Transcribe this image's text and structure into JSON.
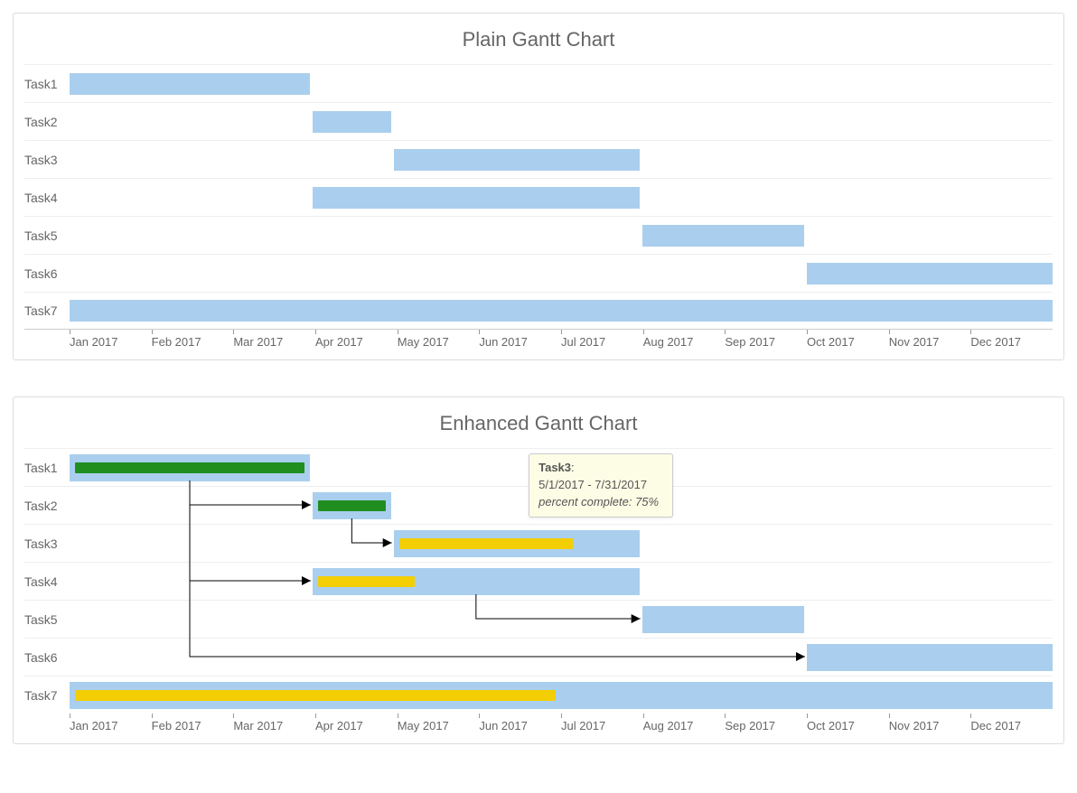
{
  "chart_data": [
    {
      "type": "gantt",
      "title": "Plain Gantt Chart",
      "x_start": "2017-01-01",
      "x_end": "2017-12-31",
      "x_ticks": [
        "Jan 2017",
        "Feb 2017",
        "Mar 2017",
        "Apr 2017",
        "May 2017",
        "Jun 2017",
        "Jul 2017",
        "Aug 2017",
        "Sep 2017",
        "Oct 2017",
        "Nov 2017",
        "Dec 2017"
      ],
      "tasks": [
        {
          "name": "Task1",
          "start": "2017-01-01",
          "end": "2017-03-31"
        },
        {
          "name": "Task2",
          "start": "2017-04-01",
          "end": "2017-04-30"
        },
        {
          "name": "Task3",
          "start": "2017-05-01",
          "end": "2017-07-31"
        },
        {
          "name": "Task4",
          "start": "2017-04-01",
          "end": "2017-07-31"
        },
        {
          "name": "Task5",
          "start": "2017-08-01",
          "end": "2017-09-30"
        },
        {
          "name": "Task6",
          "start": "2017-10-01",
          "end": "2017-12-31"
        },
        {
          "name": "Task7",
          "start": "2017-01-01",
          "end": "2017-12-31"
        }
      ]
    },
    {
      "type": "gantt",
      "title": "Enhanced Gantt Chart",
      "x_start": "2017-01-01",
      "x_end": "2017-12-31",
      "x_ticks": [
        "Jan 2017",
        "Feb 2017",
        "Mar 2017",
        "Apr 2017",
        "May 2017",
        "Jun 2017",
        "Jul 2017",
        "Aug 2017",
        "Sep 2017",
        "Oct 2017",
        "Nov 2017",
        "Dec 2017"
      ],
      "tasks": [
        {
          "name": "Task1",
          "start": "2017-01-01",
          "end": "2017-03-31",
          "percent_complete": 100,
          "progress_color": "green"
        },
        {
          "name": "Task2",
          "start": "2017-04-01",
          "end": "2017-04-30",
          "percent_complete": 100,
          "progress_color": "green",
          "depends_on": "Task1"
        },
        {
          "name": "Task3",
          "start": "2017-05-01",
          "end": "2017-07-31",
          "percent_complete": 75,
          "progress_color": "gold",
          "depends_on": "Task2"
        },
        {
          "name": "Task4",
          "start": "2017-04-01",
          "end": "2017-07-31",
          "percent_complete": 33,
          "progress_color": "gold",
          "depends_on": "Task1"
        },
        {
          "name": "Task5",
          "start": "2017-08-01",
          "end": "2017-09-30",
          "percent_complete": 0,
          "depends_on": "Task4"
        },
        {
          "name": "Task6",
          "start": "2017-10-01",
          "end": "2017-12-31",
          "percent_complete": 0,
          "depends_on": "Task1"
        },
        {
          "name": "Task7",
          "start": "2017-01-01",
          "end": "2017-12-31",
          "percent_complete": 50,
          "progress_color": "gold"
        }
      ],
      "tooltip": {
        "task": "Task3",
        "range": "5/1/2017 - 7/31/2017",
        "percent_label": "percent complete: 75%",
        "x_date": "2017-06-20"
      }
    }
  ],
  "colors": {
    "bar": "#aacfee",
    "progress_green": "#1f8e1f",
    "progress_gold": "#f2ce02",
    "tooltip_bg": "#fdfde6"
  }
}
